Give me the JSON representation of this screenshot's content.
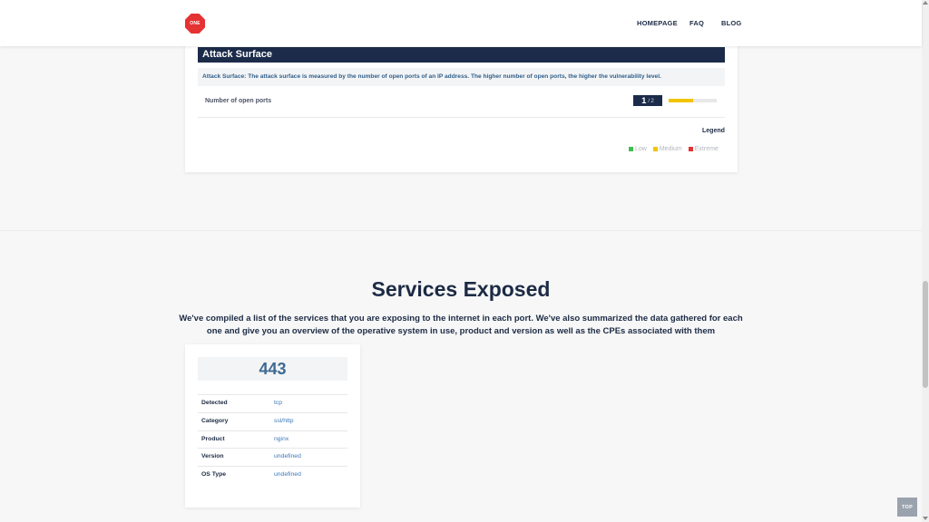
{
  "nav": {
    "logo_text": "ONE",
    "links": [
      "HOMEPAGE",
      "FAQ",
      "BLOG"
    ]
  },
  "attack_surface": {
    "title": "Attack Surface",
    "description": "Attack Surface: The attack surface is measured by the number of open ports of an IP address. The higher number of open ports, the higher the vulnerability level.",
    "ports_label": "Number of open ports",
    "open_ports": "1",
    "separator": "/",
    "max_ports": "2",
    "level_fraction": 0.5,
    "legend_title": "Legend",
    "legend": [
      {
        "label": "Low",
        "color": "#3fbf4f"
      },
      {
        "label": "Medium",
        "color": "#f2c500"
      },
      {
        "label": "Extreme",
        "color": "#e53232"
      }
    ]
  },
  "services": {
    "title": "Services Exposed",
    "description": "We've compiled a list of the services that you are exposing to the internet in each port. We've also summarized the data gathered for each one and give you an overview of the operative system in use, product and version as well as the CPEs associated with them",
    "items": [
      {
        "port": "443",
        "rows": [
          {
            "key": "Detected",
            "value": "tcp"
          },
          {
            "key": "Category",
            "value": "ssl/http"
          },
          {
            "key": "Product",
            "value": "nginx"
          },
          {
            "key": "Version",
            "value": "undefined"
          },
          {
            "key": "OS Type",
            "value": "undefined"
          }
        ]
      }
    ]
  },
  "top_button": "TOP",
  "colors": {
    "navy": "#1c2b4a",
    "accent_red": "#e53232",
    "link_blue": "#3d78b8"
  }
}
